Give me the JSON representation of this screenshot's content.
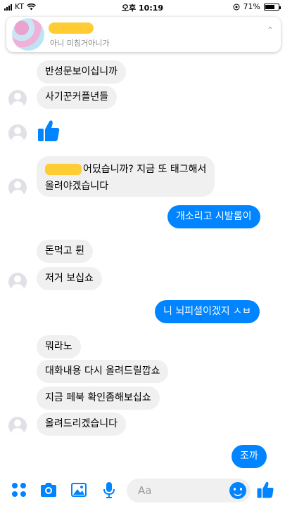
{
  "status_bar": {
    "carrier": "KT",
    "time": "오후 10:19",
    "battery": "71%",
    "battery_level": 0.71
  },
  "header": {
    "subtitle": "아니 미침거아니가"
  },
  "messages": [
    {
      "side": "in",
      "text": "반성문보이십니까"
    },
    {
      "side": "in",
      "text": "사기꾼커플년들"
    },
    {
      "side": "in",
      "type": "like"
    },
    {
      "side": "in",
      "text_line1": "어딨습니까? 지금 또 태그해서",
      "text_line2": "올려야겠습니다"
    },
    {
      "side": "out",
      "text": "개소리고 시발롬이"
    },
    {
      "side": "in",
      "text": "돈먹고 튄"
    },
    {
      "side": "in",
      "text": "저거 보십쇼"
    },
    {
      "side": "out",
      "text": "니 뇌피셜이겠지 ㅅㅂ"
    },
    {
      "side": "in",
      "text": "뭐라노"
    },
    {
      "side": "in",
      "text": "대화내용 다시 올려드릴깝쇼"
    },
    {
      "side": "in",
      "text": "지금 페북 확인좀해보십쇼"
    },
    {
      "side": "in",
      "text": "올려드리겠습니다"
    },
    {
      "side": "out",
      "text": "조까"
    }
  ],
  "composer": {
    "placeholder": "Aa"
  },
  "colors": {
    "accent": "#0084ff",
    "incoming_bubble": "#f1f0f0"
  }
}
